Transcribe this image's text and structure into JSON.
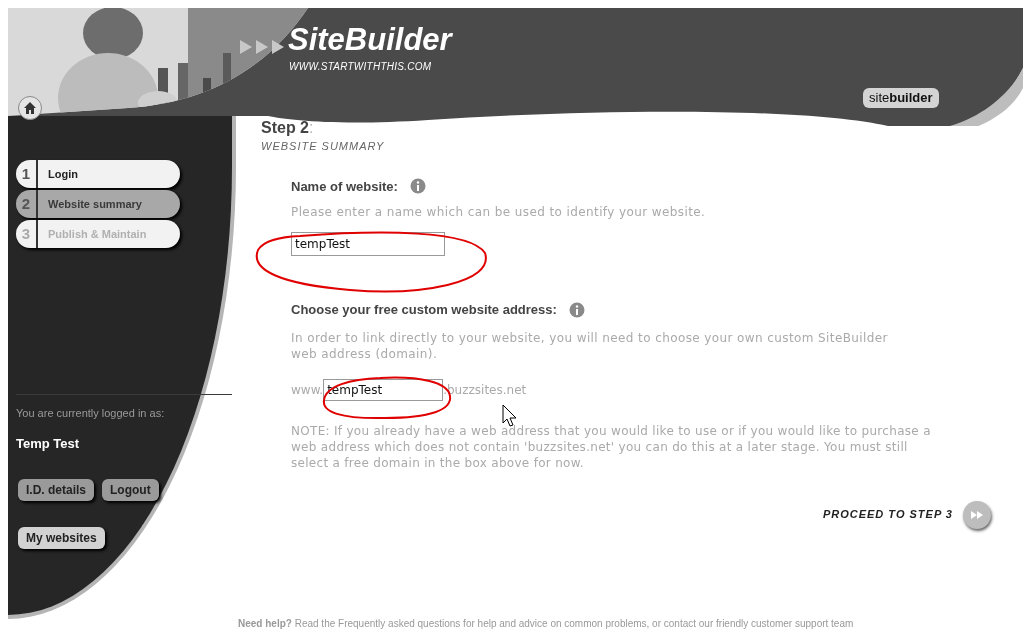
{
  "header": {
    "logo": "SiteBuilder",
    "tagline": "WWW.STARTWITHTHIS.COM",
    "tab": "site**builder**"
  },
  "steps": [
    {
      "number": "1",
      "label": "Login",
      "selected": false,
      "disabled": false
    },
    {
      "number": "2",
      "label": "Website summary",
      "selected": true,
      "disabled": false
    },
    {
      "number": "3",
      "label": "Publish & Maintain",
      "selected": false,
      "disabled": true
    }
  ],
  "account": {
    "caption": "You are currently logged in as:",
    "user": "Temp Test",
    "buttons": [
      "I.D. details",
      "Logout",
      "My websites"
    ]
  },
  "main": {
    "step_title": "Step 2",
    "step_colon": ":",
    "step_subtitle": "WEBSITE SUMMARY",
    "name_field": {
      "label": "Name of website:",
      "hint": "Please enter a name which can be used to identify your website.",
      "value": "tempTest"
    },
    "address_field": {
      "label": "Choose your free custom website address:",
      "hint": "In order to link directly to your website, you will need to choose your own custom SiteBuilder web address (domain).",
      "prefix": "www.",
      "value": "tempTest",
      "suffix": ".buzzsites.net"
    },
    "note": "NOTE: If you already have a web address that you would like to use or if you would like to purchase a web address which does not contain 'buzzsites.net' you can do this at a later stage. You must still select a free domain in the box above for now.",
    "proceed": "PROCEED TO STEP 3"
  },
  "footer": {
    "text": "**Need help?** Read the Frequently asked questions for help and advice on common problems, or contact our friendly customer support team"
  }
}
